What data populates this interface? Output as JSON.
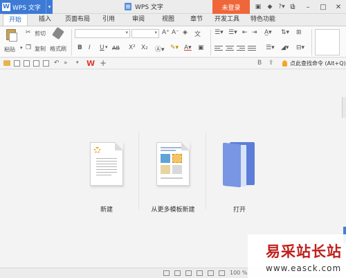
{
  "titlebar": {
    "app_name": "WPS 文字",
    "app_letter": "W",
    "doc_title": "WPS 文字",
    "login_label": "未登录",
    "icons": [
      "skin-icon",
      "shirt-icon",
      "help-icon",
      "menu-icon",
      "restore-icon"
    ],
    "window_controls": [
      "minimize-icon",
      "maximize-icon",
      "close-icon"
    ]
  },
  "tabs": [
    "开始",
    "插入",
    "页面布局",
    "引用",
    "审阅",
    "视图",
    "章节",
    "开发工具",
    "特色功能"
  ],
  "active_tab": "开始",
  "ribbon": {
    "cut_label": "剪切",
    "paste_label": "粘贴",
    "copy_label": "复制",
    "format_painter_label": "格式刷",
    "bold": "B",
    "italic": "I",
    "underline": "U",
    "strike": "AB",
    "superscript": "X²",
    "subscript": "X₂"
  },
  "quickbar": {
    "search_hint": "点此查找命令 (Alt+Q)",
    "plus": "+"
  },
  "start": {
    "new_label": "新建",
    "template_label": "从更多模板新建",
    "open_label": "打开"
  },
  "status": {
    "zoom": "100 %"
  },
  "watermark": {
    "title": "易采站长站",
    "url": "www.easck.com"
  },
  "colors": {
    "accent": "#3d7ad6",
    "login": "#f0663b",
    "wps_red": "#e03a2c",
    "watermark_red": "#c0201d"
  }
}
